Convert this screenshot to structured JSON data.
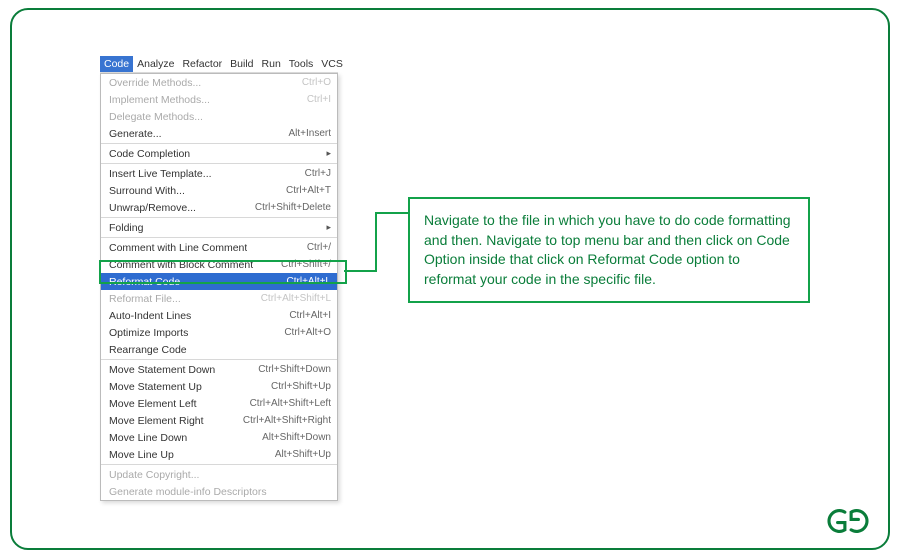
{
  "menubar": {
    "items": [
      {
        "label": "Code",
        "active": true
      },
      {
        "label": "Analyze",
        "active": false
      },
      {
        "label": "Refactor",
        "active": false
      },
      {
        "label": "Build",
        "active": false
      },
      {
        "label": "Run",
        "active": false
      },
      {
        "label": "Tools",
        "active": false
      },
      {
        "label": "VCS",
        "active": false
      }
    ]
  },
  "menu": {
    "override": {
      "label": "Override Methods...",
      "shortcut": "Ctrl+O"
    },
    "implement": {
      "label": "Implement Methods...",
      "shortcut": "Ctrl+I"
    },
    "delegate": {
      "label": "Delegate Methods...",
      "shortcut": ""
    },
    "generate": {
      "label": "Generate...",
      "shortcut": "Alt+Insert"
    },
    "completion": {
      "label": "Code Completion",
      "shortcut": ""
    },
    "livetemplate": {
      "label": "Insert Live Template...",
      "shortcut": "Ctrl+J"
    },
    "surround": {
      "label": "Surround With...",
      "shortcut": "Ctrl+Alt+T"
    },
    "unwrap": {
      "label": "Unwrap/Remove...",
      "shortcut": "Ctrl+Shift+Delete"
    },
    "folding": {
      "label": "Folding",
      "shortcut": ""
    },
    "commentline": {
      "label": "Comment with Line Comment",
      "shortcut": "Ctrl+/"
    },
    "commentblock": {
      "label": "Comment with Block Comment",
      "shortcut": "Ctrl+Shift+/"
    },
    "reformat": {
      "label": "Reformat Code",
      "shortcut": "Ctrl+Alt+L"
    },
    "reformatfile": {
      "label": "Reformat File...",
      "shortcut": "Ctrl+Alt+Shift+L"
    },
    "autoindent": {
      "label": "Auto-Indent Lines",
      "shortcut": "Ctrl+Alt+I"
    },
    "optimize": {
      "label": "Optimize Imports",
      "shortcut": "Ctrl+Alt+O"
    },
    "rearrange": {
      "label": "Rearrange Code",
      "shortcut": ""
    },
    "movestmtdown": {
      "label": "Move Statement Down",
      "shortcut": "Ctrl+Shift+Down"
    },
    "movestmtup": {
      "label": "Move Statement Up",
      "shortcut": "Ctrl+Shift+Up"
    },
    "moveelleft": {
      "label": "Move Element Left",
      "shortcut": "Ctrl+Alt+Shift+Left"
    },
    "moveelright": {
      "label": "Move Element Right",
      "shortcut": "Ctrl+Alt+Shift+Right"
    },
    "movelinedown": {
      "label": "Move Line Down",
      "shortcut": "Alt+Shift+Down"
    },
    "movelineup": {
      "label": "Move Line Up",
      "shortcut": "Alt+Shift+Up"
    },
    "updatecopyright": {
      "label": "Update Copyright...",
      "shortcut": ""
    },
    "moduleinfo": {
      "label": "Generate module-info Descriptors",
      "shortcut": ""
    }
  },
  "callout": {
    "text": "Navigate to the file in which you have to do code formatting and then. Navigate to top menu bar and then click on Code Option inside that click on Reformat Code option to reformat your code in the specific file."
  }
}
